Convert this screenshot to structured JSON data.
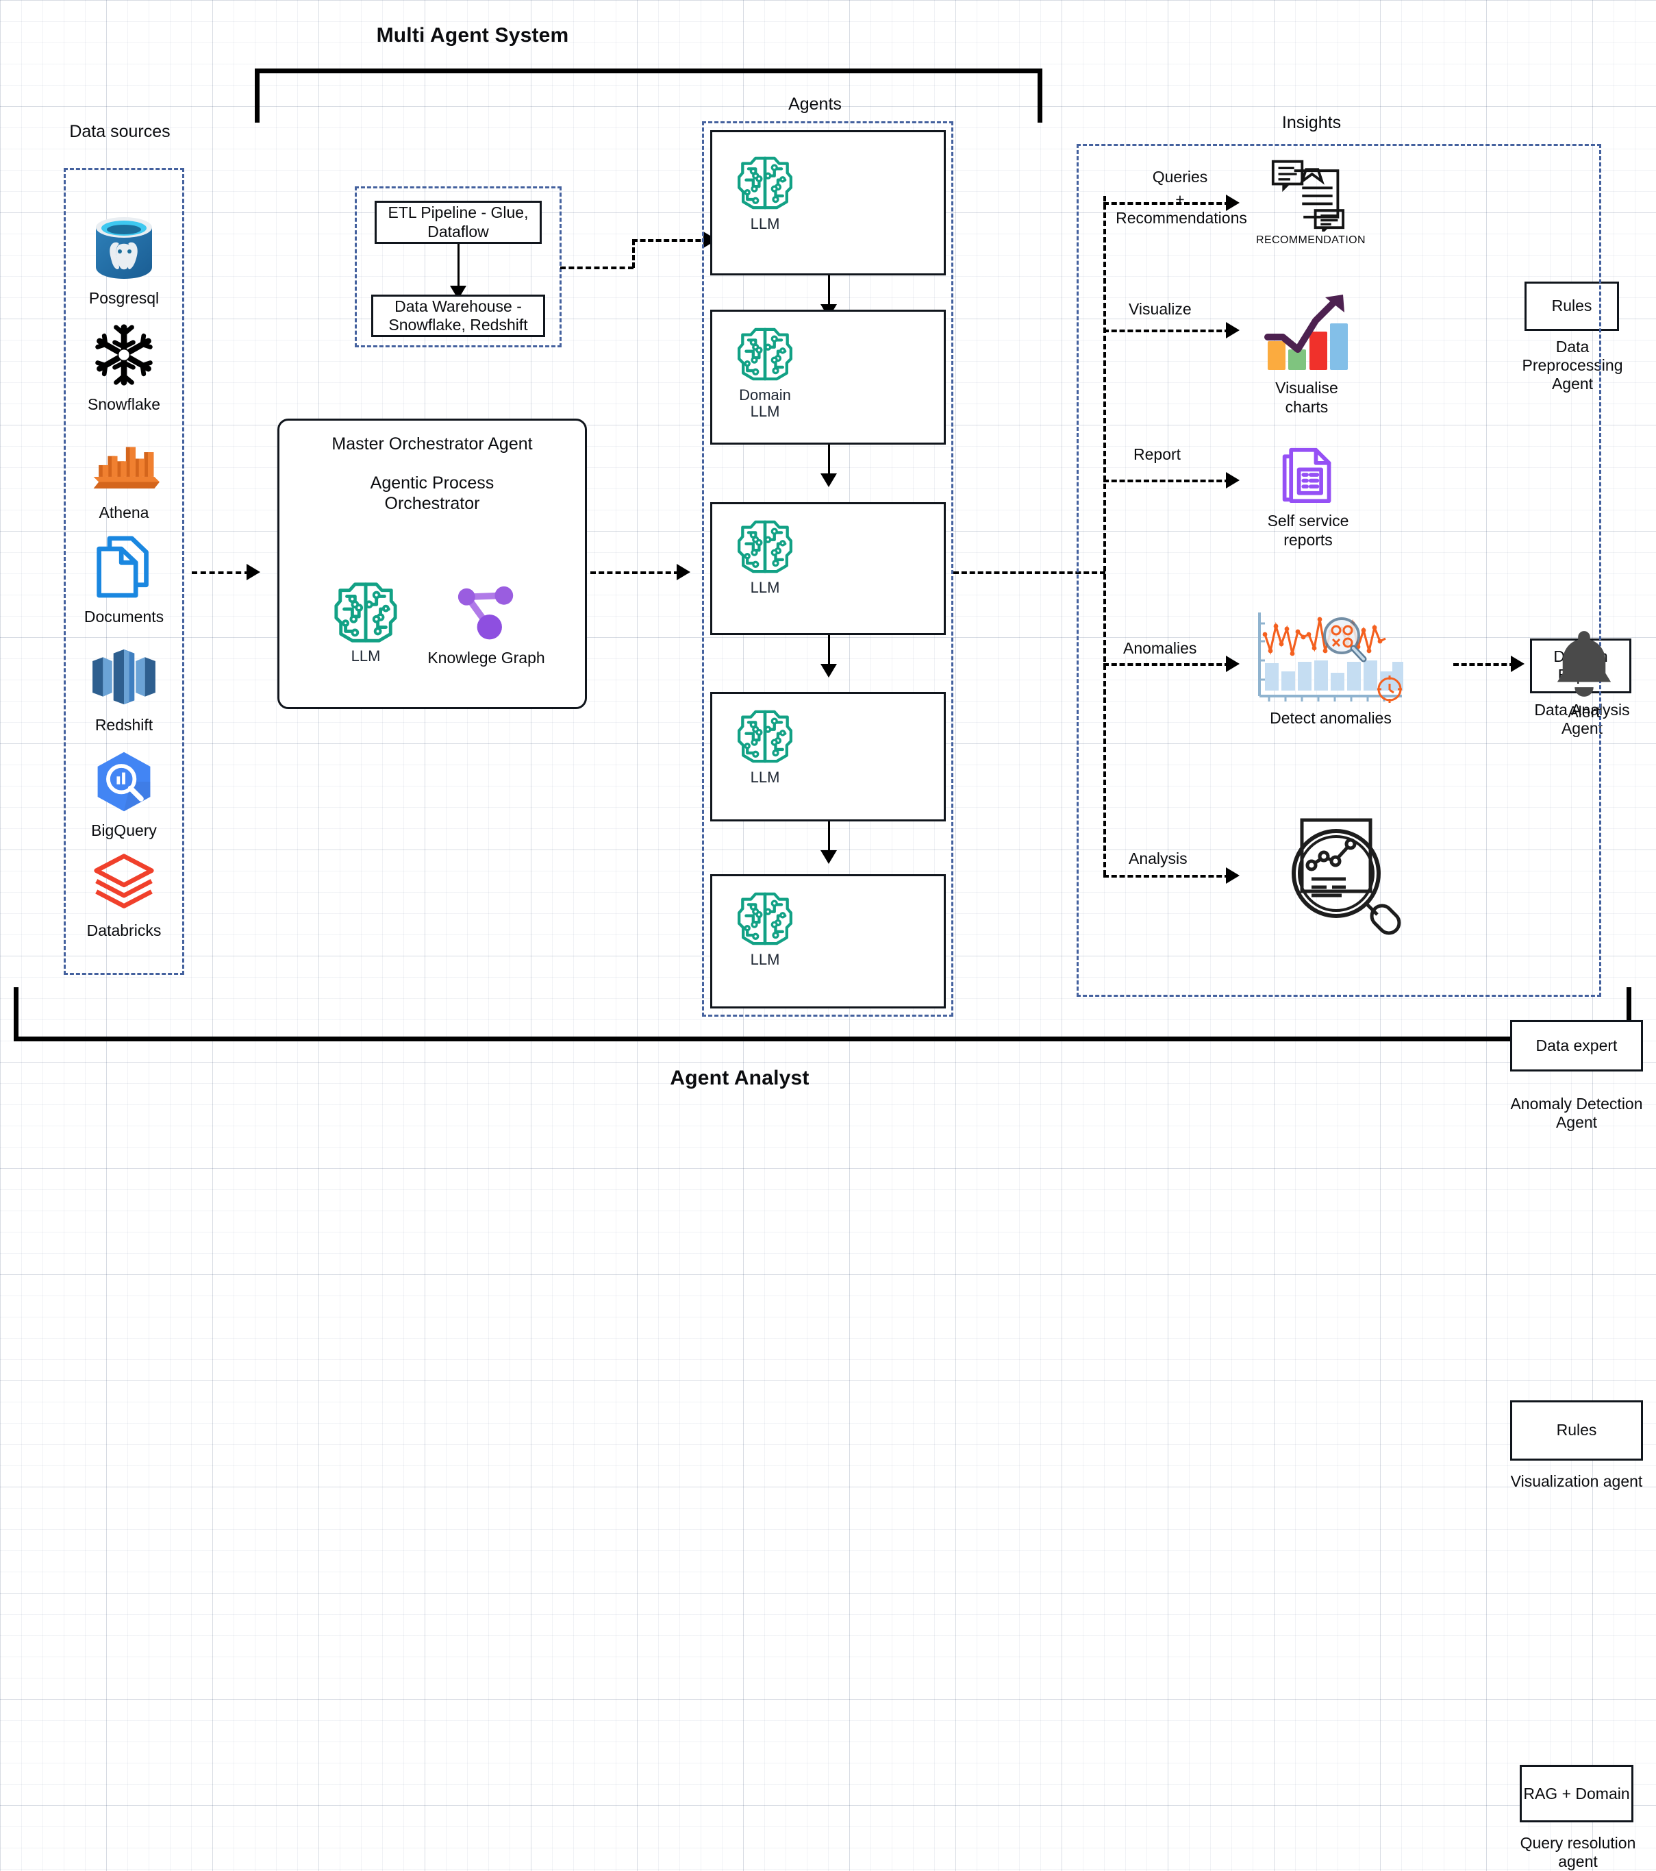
{
  "diagram": {
    "title": "Multi Agent System",
    "footer_title": "Agent Analyst"
  },
  "zones": {
    "data_sources": "Data sources",
    "agents": "Agents",
    "insights": "Insights"
  },
  "data_sources": {
    "items": [
      {
        "label": "Posgresql",
        "icon": "postgresql-icon"
      },
      {
        "label": "Snowflake",
        "icon": "snowflake-icon"
      },
      {
        "label": "Athena",
        "icon": "athena-icon"
      },
      {
        "label": "Documents",
        "icon": "documents-icon"
      },
      {
        "label": "Redshift",
        "icon": "redshift-icon"
      },
      {
        "label": "BigQuery",
        "icon": "bigquery-icon"
      },
      {
        "label": "Databricks",
        "icon": "databricks-icon"
      }
    ]
  },
  "pipeline": {
    "etl": "ETL Pipeline - Glue, Dataflow",
    "warehouse": "Data Warehouse - Snowflake, Redshift"
  },
  "orchestrator": {
    "title": "Master Orchestrator Agent",
    "subtitle": "Agentic Process Orchestrator",
    "llm_label": "LLM",
    "kg_label": "Knowlege Graph"
  },
  "agents": [
    {
      "llm": "LLM",
      "badge": "Rules",
      "name": "Data Preprocessing Agent"
    },
    {
      "llm": "Domain LLM",
      "badge": "Domain Expert",
      "name": "Data Analysis Agent"
    },
    {
      "llm": "LLM",
      "badge": "Data expert",
      "name": "Anomaly Detection Agent"
    },
    {
      "llm": "LLM",
      "badge": "Rules",
      "name": "Visualization agent"
    },
    {
      "llm": "LLM",
      "badge": "RAG + Domain",
      "name": "Query resolution agent"
    }
  ],
  "insights": {
    "rows": [
      {
        "edge": "Queries + Recommendations",
        "edge_line1": "Queries",
        "edge_plus": "+",
        "edge_line2": "Recommendations",
        "caption": "RECOMMENDATION",
        "icon": "recommendation-document-icon"
      },
      {
        "edge": "Visualize",
        "caption": "Visualise charts",
        "icon": "bar-chart-growth-icon"
      },
      {
        "edge": "Report",
        "caption": "Self service reports",
        "icon": "report-documents-icon"
      },
      {
        "edge": "Anomalies",
        "caption": "Detect anomalies",
        "icon": "anomaly-chart-icon"
      },
      {
        "edge": "Analysis",
        "caption": "",
        "icon": "document-magnifier-icon"
      }
    ],
    "alert_label": "Alert",
    "alert_icon": "bell-icon"
  },
  "colors": {
    "brain_teal": "#12a185",
    "knowledge_graph_purple": "#9a5de0",
    "zone_border_blue": "#44619e",
    "postgres_blue": "#31648c",
    "athena_orange": "#e8762d",
    "documents_blue": "#1a87e0",
    "redshift_blue": "#2c5f8f",
    "bigquery_blue": "#4285f4",
    "databricks_red": "#f0402b",
    "chart_orange": "#fbab3f",
    "chart_green": "#7fc47f",
    "chart_red": "#f0312b",
    "chart_blue": "#83bfe8",
    "chart_arrow_purple": "#4d2150",
    "report_purple": "#9550f5",
    "anomaly_orange": "#f4601f",
    "anomaly_bar_blue": "#c5ddf2",
    "alert_gray": "#4a4a4a"
  }
}
